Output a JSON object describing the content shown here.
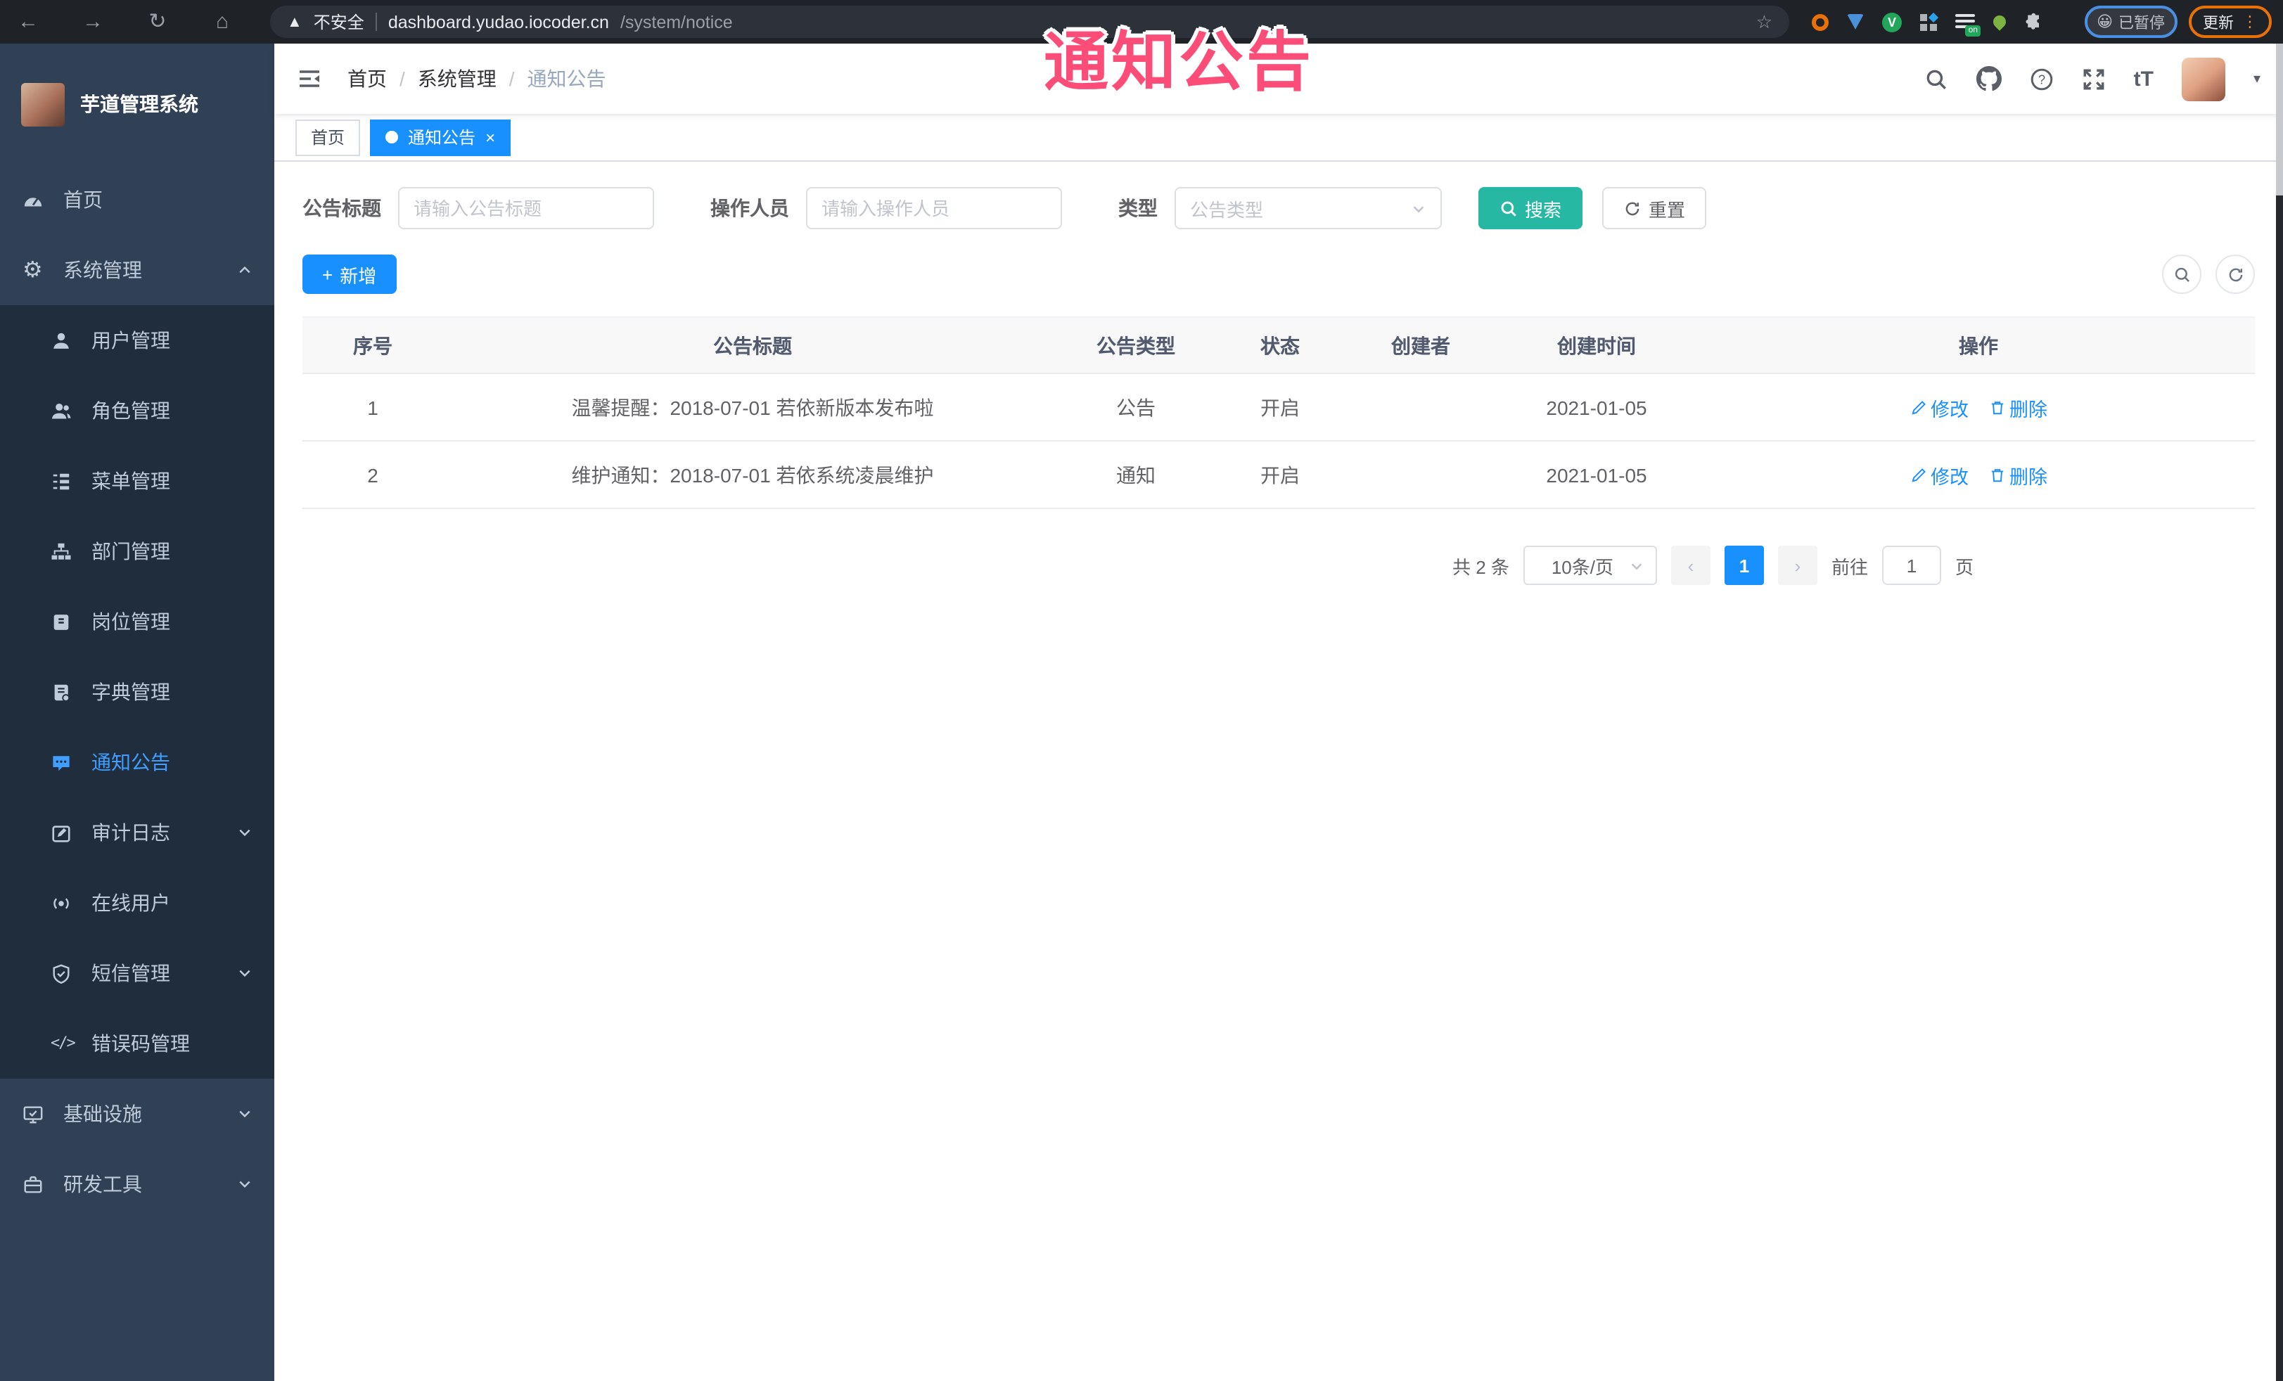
{
  "browser": {
    "security_label": "不安全",
    "url_host": "dashboard.yudao.iocoder.cn",
    "url_path": "/system/notice",
    "extension_badge": "on",
    "profile_status": "已暂停",
    "update_label": "更新"
  },
  "watermark": "通知公告",
  "sidebar": {
    "app_title": "芋道管理系统",
    "home": "首页",
    "system": "系统管理",
    "sub_items": [
      {
        "label": "用户管理"
      },
      {
        "label": "角色管理"
      },
      {
        "label": "菜单管理"
      },
      {
        "label": "部门管理"
      },
      {
        "label": "岗位管理"
      },
      {
        "label": "字典管理"
      },
      {
        "label": "通知公告"
      },
      {
        "label": "审计日志"
      },
      {
        "label": "在线用户"
      },
      {
        "label": "短信管理"
      },
      {
        "label": "错误码管理"
      }
    ],
    "infra": "基础设施",
    "devtools": "研发工具"
  },
  "navbar": {
    "breadcrumb": [
      "首页",
      "系统管理",
      "通知公告"
    ]
  },
  "tabs": [
    {
      "label": "首页"
    },
    {
      "label": "通知公告"
    }
  ],
  "filter": {
    "title_label": "公告标题",
    "title_placeholder": "请输入公告标题",
    "operator_label": "操作人员",
    "operator_placeholder": "请输入操作人员",
    "type_label": "类型",
    "type_placeholder": "公告类型",
    "search_label": "搜索",
    "reset_label": "重置"
  },
  "toolbar": {
    "add_label": "新增"
  },
  "table": {
    "columns": [
      "序号",
      "公告标题",
      "公告类型",
      "状态",
      "创建者",
      "创建时间",
      "操作"
    ],
    "rows": [
      {
        "index": "1",
        "title": "温馨提醒：2018-07-01 若依新版本发布啦",
        "type": "公告",
        "status": "开启",
        "creator": "",
        "create_time": "2021-01-05"
      },
      {
        "index": "2",
        "title": "维护通知：2018-07-01 若依系统凌晨维护",
        "type": "通知",
        "status": "开启",
        "creator": "",
        "create_time": "2021-01-05"
      }
    ],
    "edit_label": "修改",
    "delete_label": "删除"
  },
  "pagination": {
    "total": "共 2 条",
    "page_size": "10条/页",
    "current_page": "1",
    "goto_label": "前往",
    "goto_value": "1",
    "page_unit": "页"
  },
  "colors": {
    "primary": "#1890ff",
    "search_button": "#26b8a3",
    "sidebar_bg": "#304156",
    "submenu_bg": "#1f2d3d",
    "active_menu": "#409eff",
    "watermark": "#fb4d78"
  }
}
